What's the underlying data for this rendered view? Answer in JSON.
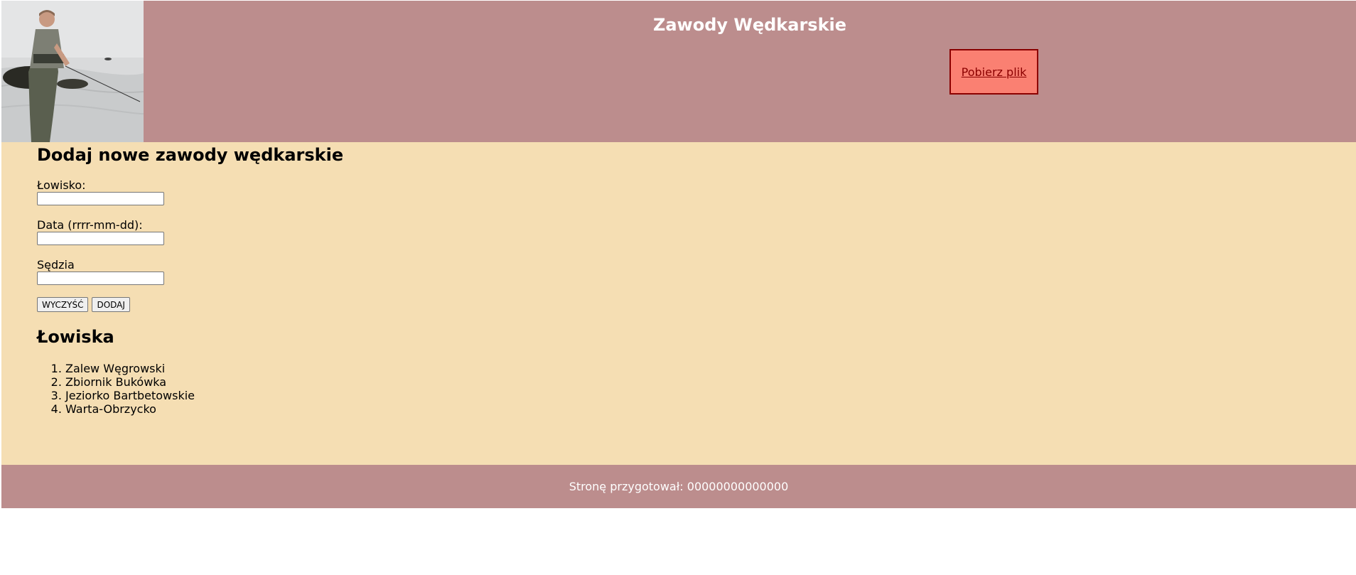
{
  "header": {
    "title": "Zawody Wędkarskie",
    "download_label": "Pobierz plik",
    "image": "fisherman-photo"
  },
  "form": {
    "title": "Dodaj nowe zawody wędkarskie",
    "fields": [
      {
        "label": "Łowisko:",
        "value": ""
      },
      {
        "label": "Data (rrrr-mm-dd):",
        "value": ""
      },
      {
        "label": "Sędzia",
        "value": ""
      }
    ],
    "clear_label": "WYCZYŚĆ",
    "add_label": "DODAJ"
  },
  "fisheries": {
    "title": "Łowiska",
    "items": [
      "Zalew Węgrowski",
      "Zbiornik Bukówka",
      "Jeziorko Bartbetowskie",
      "Warta-Obrzycko"
    ]
  },
  "footer": {
    "text": "Stronę przygotował: 00000000000000"
  },
  "colors": {
    "header_bg": "#bc8d8d",
    "main_bg": "#f5deb3",
    "download_bg": "#fa8072",
    "download_border": "#8b0000"
  }
}
